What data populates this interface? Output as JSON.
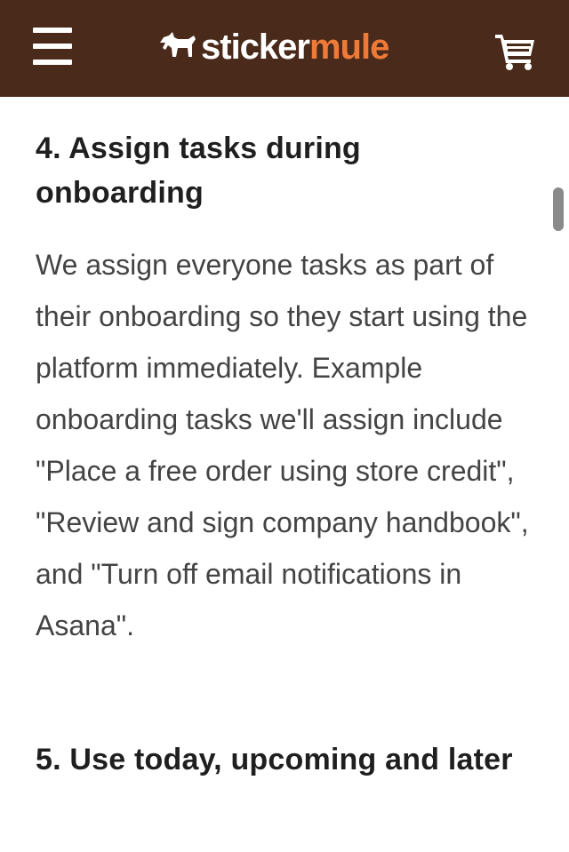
{
  "header": {
    "brand_part1": "sticker",
    "brand_part2": "mule",
    "menu_icon": "hamburger-menu-icon",
    "cart_icon": "shopping-cart-icon",
    "bg_color": "#4a2a1a",
    "accent_color": "#ee7a38"
  },
  "article": {
    "section4_heading": "4. Assign tasks during onboarding",
    "section4_body": "We assign everyone tasks as part of their onboarding so they start using the platform immediately. Example onboarding tasks we'll assign include \"Place a free order using store credit\", \"Review and sign company handbook\", and \"Turn off email notifications in Asana\".",
    "section5_heading": "5. Use today, upcoming and later"
  }
}
